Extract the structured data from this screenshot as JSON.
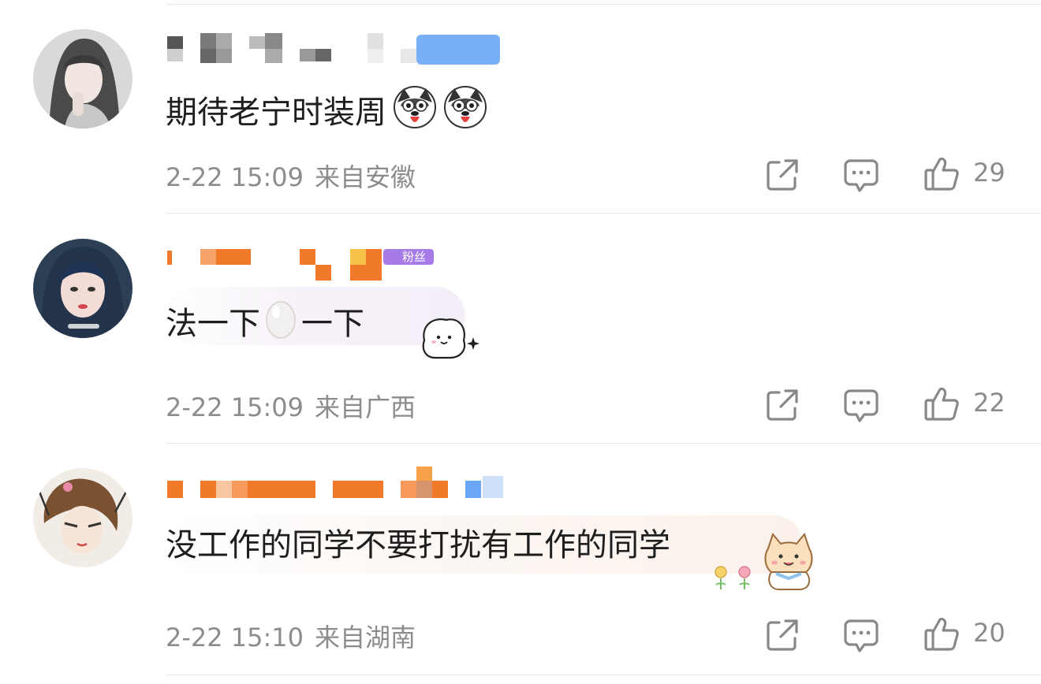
{
  "comments": [
    {
      "text": "期待老宁时装周",
      "time": "2-22 15:09",
      "location": "来自安徽",
      "likes": "29",
      "emojis": [
        "husky-emoji",
        "husky-emoji"
      ]
    },
    {
      "text_part1": "法一下",
      "text_part2": "一下",
      "time": "2-22 15:09",
      "location": "来自广西",
      "likes": "22",
      "inline_emoji": "egg-emoji",
      "badge_text": "粉丝"
    },
    {
      "text": "没工作的同学不要打扰有工作的同学",
      "time": "2-22 15:10",
      "location": "来自湖南",
      "likes": "20"
    }
  ],
  "icons": {
    "share": "share-icon",
    "reply": "comment-icon",
    "like": "thumbs-up-icon"
  },
  "colors": {
    "meta_text": "#8c8c8c",
    "divider": "#e6e6e6",
    "name_orange": "#f07a2a",
    "name_blue": "#6aa6f4",
    "badge_purple": "#a67be8"
  }
}
